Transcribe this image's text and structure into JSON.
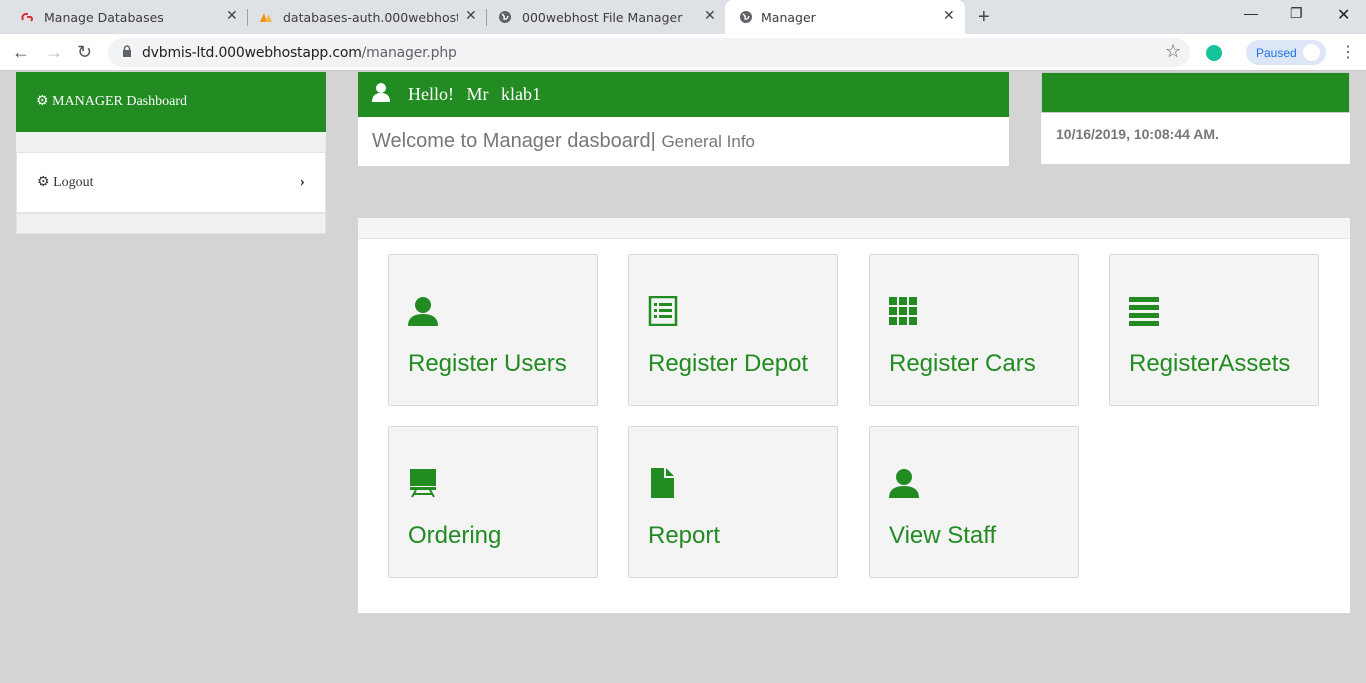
{
  "browser": {
    "tabs": [
      {
        "title": "Manage Databases",
        "active": false
      },
      {
        "title": "databases-auth.000webhost.com",
        "active": false
      },
      {
        "title": "000webhost File Manager",
        "active": false
      },
      {
        "title": "Manager",
        "active": true
      }
    ],
    "url_host": "dvbmis-ltd.000webhostapp.com",
    "url_path": "/manager.php",
    "profile_status": "Paused"
  },
  "sidebar": {
    "title": "MANAGER Dashboard",
    "logout_label": "Logout"
  },
  "header": {
    "greeting": "Hello!",
    "salutation": "Mr",
    "username": "klab1",
    "welcome": "Welcome to Manager dasboard|",
    "subtitle": "General Info"
  },
  "clock": {
    "datetime": "10/16/2019, 10:08:44 AM."
  },
  "tiles": [
    {
      "label": "Register Users",
      "icon": "user-icon"
    },
    {
      "label": "Register Depot",
      "icon": "list-alt-icon"
    },
    {
      "label": "Register Cars",
      "icon": "th-icon"
    },
    {
      "label": "RegisterAssets",
      "icon": "align-justify-icon"
    },
    {
      "label": "Ordering",
      "icon": "blackboard-icon"
    },
    {
      "label": "Report",
      "icon": "file-icon"
    },
    {
      "label": "View Staff",
      "icon": "user-icon"
    }
  ],
  "colors": {
    "brand_green": "#228b22",
    "background": "#d4d4d4"
  }
}
